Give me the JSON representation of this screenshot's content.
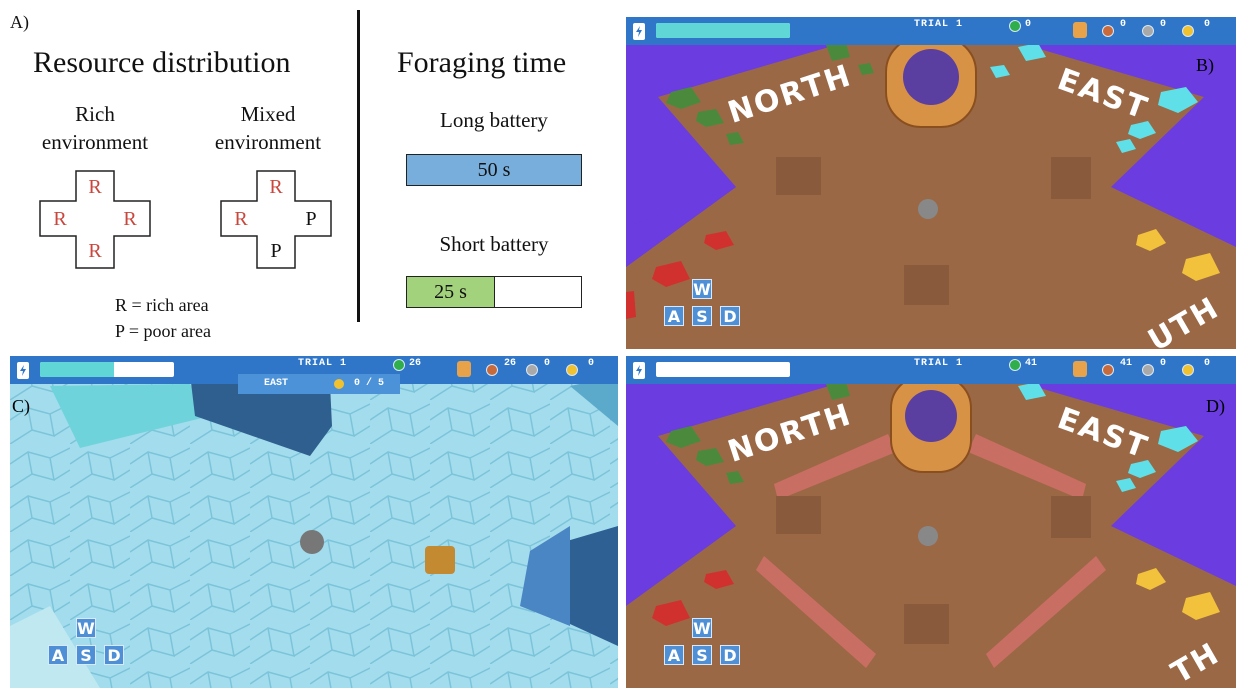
{
  "panel_a": {
    "letter": "A)",
    "resource_title": "Resource distribution",
    "rich_label": [
      "Rich",
      "environment"
    ],
    "mixed_label": [
      "Mixed",
      "environment"
    ],
    "rich_cells": {
      "top": "R",
      "left": "R",
      "right": "R",
      "bottom": "R"
    },
    "mixed_cells": {
      "top": "R",
      "left": "R",
      "right": "P",
      "bottom": "P"
    },
    "legend": [
      "R = rich area",
      "P = poor area"
    ],
    "foraging_title": "Foraging time",
    "long_label": "Long battery",
    "long_value": "50 s",
    "short_label": "Short battery",
    "short_value": "25 s",
    "short_fill_fraction": 0.5,
    "colors": {
      "rich_letter": "#c9463d",
      "long_bar": "#78aedb",
      "short_bar": "#a3d27d"
    }
  },
  "panel_b": {
    "letter": "B)",
    "trial": "TRIAL 1",
    "coins": "0",
    "bronze": "0",
    "silver": "0",
    "gold": "0",
    "battery_fraction": 1.0,
    "labels": {
      "north": "NORTH",
      "east": "EAST",
      "south": "UTH"
    }
  },
  "panel_c": {
    "letter": "C)",
    "trial": "TRIAL 1",
    "coins": "26",
    "bronze": "26",
    "silver": "0",
    "gold": "0",
    "battery_fraction": 0.55,
    "area_name": "EAST",
    "area_progress": "0 / 5"
  },
  "panel_d": {
    "letter": "D)",
    "trial": "TRIAL 1",
    "coins": "41",
    "bronze": "41",
    "silver": "0",
    "gold": "0",
    "battery_fraction": 0.0,
    "labels": {
      "north": "NORTH",
      "east": "EAST",
      "south": "TH"
    }
  },
  "controls": {
    "w": "W",
    "a": "A",
    "s": "S",
    "d": "D"
  }
}
